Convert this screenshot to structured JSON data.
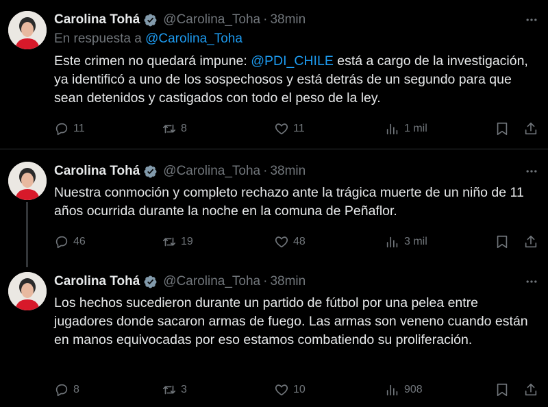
{
  "tweets": [
    {
      "name": "Carolina Tohá",
      "handle": "@Carolina_Toha",
      "separator": "·",
      "time": "38min",
      "reply_prefix": "En respuesta a",
      "reply_handle": "@Carolina_Toha",
      "text_before": "Este crimen no quedará impune: ",
      "mention": "@PDI_CHILE",
      "text_after": " está a cargo de la investigación, ya identificó a uno de los sospechosos y está detrás de un segundo para que sean detenidos y castigados con todo el peso de la ley.",
      "replies": "11",
      "retweets": "8",
      "likes": "11",
      "views": "1 mil"
    },
    {
      "name": "Carolina Tohá",
      "handle": "@Carolina_Toha",
      "separator": "·",
      "time": "38min",
      "text": "Nuestra conmoción y completo rechazo ante la trágica muerte de un niño de 11 años ocurrida durante la noche en la comuna de Peñaflor.",
      "replies": "46",
      "retweets": "19",
      "likes": "48",
      "views": "3 mil"
    },
    {
      "name": "Carolina Tohá",
      "handle": "@Carolina_Toha",
      "separator": "·",
      "time": "38min",
      "text": "Los hechos sucedieron durante un partido de fútbol por una pelea entre jugadores donde sacaron armas de fuego. Las armas son veneno cuando están en manos equivocadas  por eso estamos combatiendo su proliferación.",
      "replies": "8",
      "retweets": "3",
      "likes": "10",
      "views": "908"
    }
  ],
  "colors": {
    "background": "#000000",
    "text": "#e7e9ea",
    "muted": "#71767b",
    "link": "#1d9bf0",
    "verified": "#829aab",
    "divider": "#2f3336"
  }
}
